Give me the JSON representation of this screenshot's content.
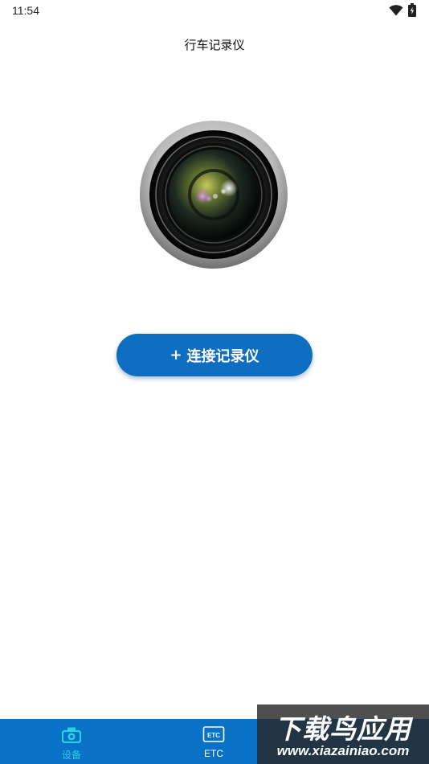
{
  "status_bar": {
    "time": "11:54",
    "icons": [
      "wifi-icon",
      "battery-icon"
    ]
  },
  "header": {
    "title": "行车记录仪"
  },
  "main": {
    "illustration": "camera-lens-icon",
    "connect_button": {
      "plus": "+",
      "label": "连接记录仪"
    }
  },
  "bottom_nav": {
    "items": [
      {
        "label": "设备",
        "icon": "camera-icon",
        "active": true
      },
      {
        "label": "ETC",
        "icon": "etc-icon",
        "active": false
      }
    ]
  },
  "watermark": {
    "title": "下载鸟应用",
    "url": "www.xiazainiao.com"
  },
  "colors": {
    "primary": "#0e6fc2",
    "nav_bg": "#0a72c6",
    "nav_active": "#28d0e8",
    "background": "#ffffff"
  }
}
